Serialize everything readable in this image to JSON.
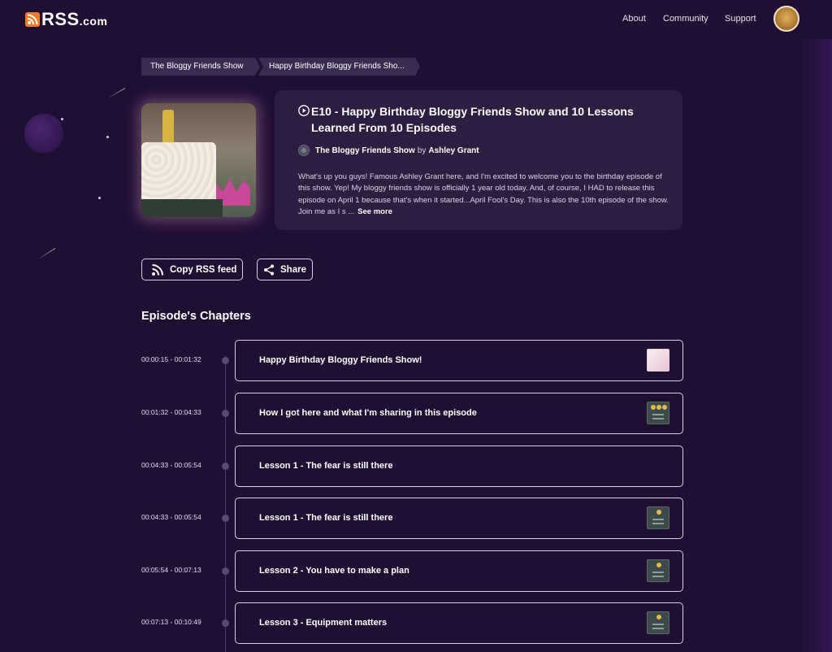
{
  "header": {
    "logo_text": "RSS",
    "logo_suffix": ".com",
    "nav": [
      "About",
      "Community",
      "Support"
    ]
  },
  "breadcrumb": [
    "The Bloggy Friends Show",
    "Happy Birthday Bloggy Friends Sho..."
  ],
  "episode": {
    "title": "E10 - Happy Birthday Bloggy Friends Show and 10 Lessons Learned From 10 Episodes",
    "show_name": "The Bloggy Friends Show",
    "by_label": "by",
    "author": "Ashley Grant",
    "description": "What's up you guys! Famous Ashley Grant here, and I'm excited to welcome you to the birthday episode of this show. Yep! My bloggy friends show is officially 1 year old today. And, of course, I HAD to release this episode on April 1 because that's when it started...April Fool's Day. This is also the 10th episode of the show. Join me as I s ...",
    "see_more": "See more"
  },
  "actions": {
    "copy_rss": "Copy RSS feed",
    "share": "Share"
  },
  "chapters_title": "Episode's Chapters",
  "chapters": [
    {
      "time": "00:00:15 - 00:01:32",
      "title": "Happy Birthday Bloggy Friends Show!",
      "thumb": "pink"
    },
    {
      "time": "00:01:32 - 00:04:33",
      "title": "How I got here and what I'm sharing in this episode",
      "thumb": "dark"
    },
    {
      "time": "00:04:33 - 00:05:54",
      "title": "Lesson 1 - The fear is still there",
      "thumb": "none"
    },
    {
      "time": "00:04:33 - 00:05:54",
      "title": "Lesson 1 - The fear is still there",
      "thumb": "dark"
    },
    {
      "time": "00:05:54 - 00:07:13",
      "title": "Lesson 2 - You have to make a plan",
      "thumb": "dark"
    },
    {
      "time": "00:07:13 - 00:10:49",
      "title": "Lesson 3 - Equipment matters",
      "thumb": "dark"
    }
  ],
  "colors": {
    "background": "#1f0f33",
    "card": "#2d1d40",
    "accent_orange": "#f47c20",
    "breadcrumb_bg": "#3a2b52"
  }
}
